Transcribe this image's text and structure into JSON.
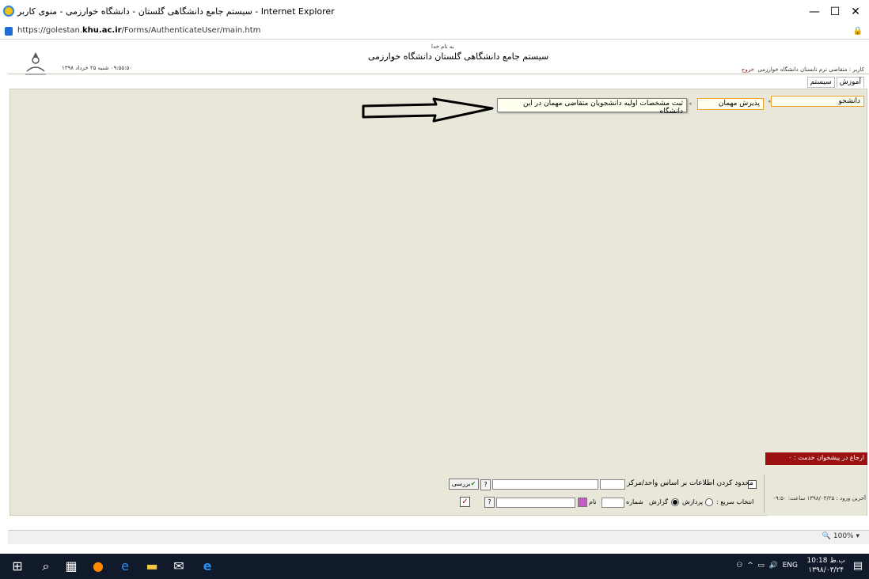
{
  "window": {
    "title": "سیستم جامع دانشگاهی گلستان - دانشگاه خوارزمی - منوی کاربر - Internet Explorer",
    "minimize": "—",
    "maximize": "☐",
    "close": "✕"
  },
  "address": {
    "url_prefix": "https://golestan.",
    "url_domain": "khu.ac.ir",
    "url_path": "/Forms/AuthenticateUser/main.htm"
  },
  "header": {
    "bismillah": "به نام خدا",
    "system_name": "سیستم جامع دانشگاهی گلستان    دانشگاه خوارزمی",
    "date_time": "۰۹:۵۵:۵۰ شنبه ۲۵ خرداد ۱۳۹۸",
    "user_text": "کاربر : متقاضی ترم تابستان دانشگاه خوارزمی",
    "logout": "خروج"
  },
  "tabs": [
    {
      "label": "آموزش",
      "active": true
    },
    {
      "label": "سیستم",
      "active": false
    }
  ],
  "menu": {
    "student": "دانشجو",
    "guest_admission": "پذیرش مهمان",
    "record_initial": "ثبت مشخصات اولیه دانشجویان متقاضی مهمان در این دانشگاه"
  },
  "referral": "ارجاع در پیشخوان خدمت : ۰",
  "last_login": "آخرین ورود : ۱۳۹۸/۰۳/۲۵ ساعت: ۰۹:۵۰",
  "bottom": {
    "limit_label": "محدود کردن اطلاعات بر اساس واحد/مرکز",
    "review_button": "بررسی",
    "help_q": "?",
    "quick_select": "انتخاب سریع :",
    "process": "پردازش",
    "report": "گزارش",
    "number": "شماره",
    "name": "نام"
  },
  "statusbar": {
    "zoom": "100%"
  },
  "taskbar": {
    "time": "10:18 ب.ظ",
    "date": "۱۳۹۸/۰۳/۲۴",
    "lang": "ENG"
  }
}
